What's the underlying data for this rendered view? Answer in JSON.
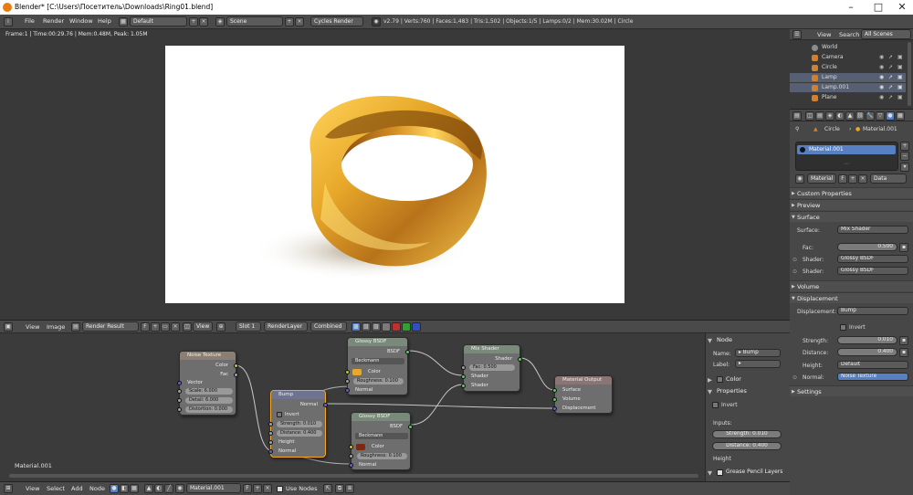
{
  "window": {
    "title": "Blender* [C:\\Users\\Посетитель\\Downloads\\Ring01.blend]",
    "min_glyph": "–",
    "max_glyph": "□",
    "close_glyph": "✕"
  },
  "info_header": {
    "menus": [
      "File",
      "Render",
      "Window",
      "Help"
    ],
    "screen_layout": "Default",
    "scene": "Scene",
    "engine": "Cycles Render",
    "stats": "v2.79 | Verts:760 | Faces:1,483 | Tris:1,502 | Objects:1/5 | Lamps:0/2 | Mem:30.02M | Circle"
  },
  "viewport": {
    "frame_info": "Frame:1 | Time:00:29.76 | Mem:0.48M, Peak: 1.05M"
  },
  "image_editor": {
    "menus": [
      "View",
      "Image"
    ],
    "image_name": "Render Result",
    "f_label": "F",
    "view_menu": "View",
    "slot": "Slot 1",
    "layer": "RenderLayer",
    "pass": "Combined"
  },
  "nodes": {
    "noise": {
      "title": "Noise Texture",
      "out_color": "Color",
      "out_fac": "Fac",
      "in_vector": "Vector",
      "scale": "Scale:",
      "scale_v": "6.000",
      "detail": "Detail:",
      "detail_v": "6.000",
      "distortion": "Distortion:",
      "distortion_v": "0.000"
    },
    "bump": {
      "title": "Bump",
      "out_normal": "Normal",
      "invert": "Invert",
      "strength": "Strength:",
      "strength_v": "0.010",
      "distance": "Distance:",
      "distance_v": "0.400",
      "in_height": "Height",
      "in_normal": "Normal"
    },
    "glossy1": {
      "title": "Glossy BSDF",
      "out_bsdf": "BSDF",
      "distribution": "Beckmann",
      "color": "Color",
      "roughness": "Roughness:",
      "roughness_v": "0.100",
      "in_normal": "Normal"
    },
    "glossy2": {
      "title": "Glossy BSDF",
      "out_bsdf": "BSDF",
      "distribution": "Beckmann",
      "color": "Color",
      "roughness": "Roughness:",
      "roughness_v": "0.100",
      "in_normal": "Normal"
    },
    "mix": {
      "title": "Mix Shader",
      "out_shader": "Shader",
      "fac": "Fac:",
      "fac_v": "0.500",
      "in_shader1": "Shader",
      "in_shader2": "Shader"
    },
    "output": {
      "title": "Material Output",
      "surface": "Surface",
      "volume": "Volume",
      "displacement": "Displacement"
    },
    "material_label": "Material.001"
  },
  "node_panel": {
    "node_header": "Node",
    "name_label": "Name:",
    "name_value": "Bump",
    "label_label": "Label:",
    "color_header": "Color",
    "properties_header": "Properties",
    "invert": "Invert",
    "inputs_label": "Inputs:",
    "strength": "Strength:",
    "strength_v": "0.010",
    "distance": "Distance:",
    "distance_v": "0.400",
    "height": "Height",
    "grease_pencil": "Grease Pencil Layers"
  },
  "bottom_header": {
    "menus": [
      "View",
      "Select",
      "Add",
      "Node"
    ],
    "material": "Material.001",
    "f_label": "F",
    "use_nodes": "Use Nodes"
  },
  "outliner": {
    "menus": [
      "View",
      "Search"
    ],
    "filter": "All Scenes",
    "items": [
      {
        "label": "World",
        "color": "#8c8c8c"
      },
      {
        "label": "Camera",
        "color": "#d08030"
      },
      {
        "label": "Circle",
        "color": "#d08030"
      },
      {
        "label": "Lamp",
        "color": "#d08030"
      },
      {
        "label": "Lamp.001",
        "color": "#d08030"
      },
      {
        "label": "Plane",
        "color": "#d08030"
      }
    ]
  },
  "properties": {
    "breadcrumb_object": "Circle",
    "breadcrumb_material": "Material.001",
    "slot_material": "Material.001",
    "material_field": "Material",
    "f_label": "F",
    "data_select": "Data",
    "sections": {
      "custom": "Custom Properties",
      "preview": "Preview",
      "surface": "Surface",
      "volume": "Volume",
      "displacement": "Displacement",
      "settings": "Settings"
    },
    "surface_label": "Surface:",
    "surface_value": "Mix Shader",
    "fac_label": "Fac:",
    "fac_value": "0.500",
    "shader_label": "Shader:",
    "shader1_value": "Glossy BSDF",
    "shader2_value": "Glossy BSDF",
    "displacement_label": "Displacement:",
    "displacement_value": "Bump",
    "invert": "Invert",
    "strength_label": "Strength:",
    "strength_value": "0.010",
    "distance_label": "Distance:",
    "distance_value": "0.400",
    "height_label": "Height:",
    "height_value": "Default",
    "normal_label": "Normal:",
    "normal_value": "Noise Texture"
  },
  "colors": {
    "gold": "#e8a92a",
    "selected_blue": "#5680c2",
    "node_select": "#f5a623"
  }
}
